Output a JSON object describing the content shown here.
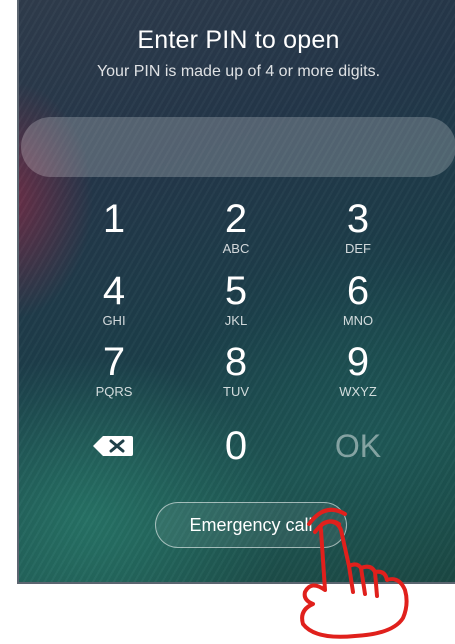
{
  "header": {
    "title": "Enter PIN to open",
    "subtitle": "Your PIN is made up of 4 or more digits."
  },
  "pin_field": {
    "value": ""
  },
  "keypad": {
    "keys": [
      {
        "digit": "1",
        "letters": ""
      },
      {
        "digit": "2",
        "letters": "ABC"
      },
      {
        "digit": "3",
        "letters": "DEF"
      },
      {
        "digit": "4",
        "letters": "GHI"
      },
      {
        "digit": "5",
        "letters": "JKL"
      },
      {
        "digit": "6",
        "letters": "MNO"
      },
      {
        "digit": "7",
        "letters": "PQRS"
      },
      {
        "digit": "8",
        "letters": "TUV"
      },
      {
        "digit": "9",
        "letters": "WXYZ"
      },
      {
        "digit": "0",
        "letters": ""
      }
    ],
    "backspace_icon": "backspace-icon",
    "ok_label": "OK"
  },
  "emergency_call": {
    "label": "Emergency call"
  },
  "annotation": {
    "icon": "tapping-hand-icon",
    "color": "#e0201c"
  }
}
